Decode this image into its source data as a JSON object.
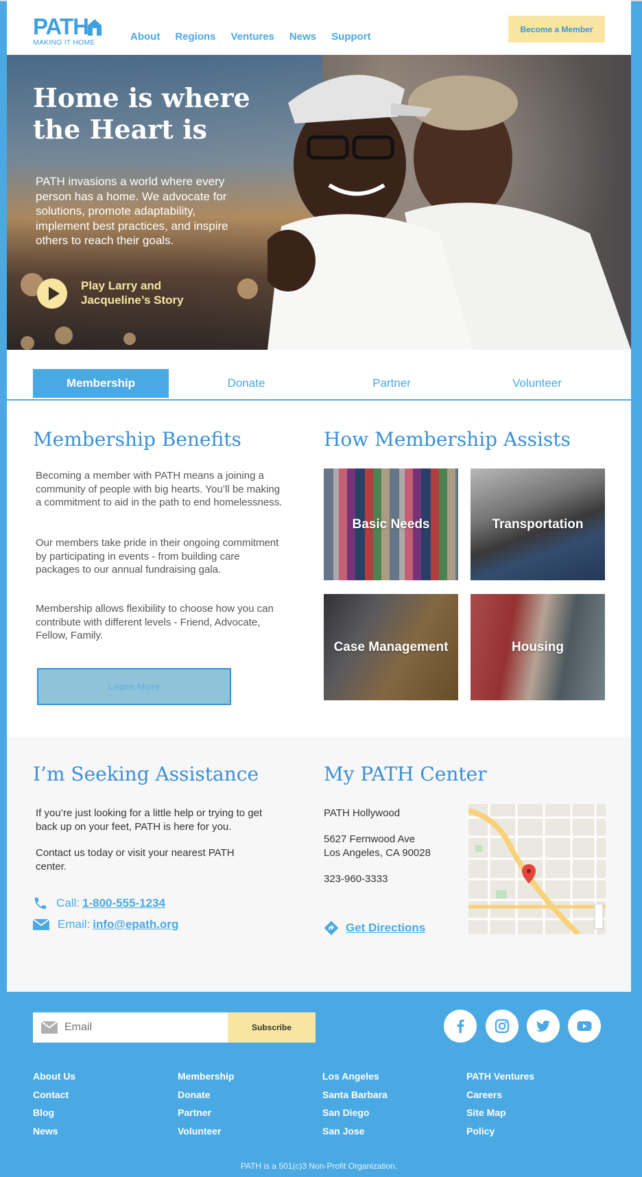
{
  "header": {
    "logo_text": "PATH",
    "logo_tagline": "MAKING IT HOME",
    "nav": [
      "About",
      "Regions",
      "Ventures",
      "News",
      "Support"
    ],
    "cta": "Become a Member"
  },
  "hero": {
    "title": "Home is where the Heart is",
    "description": "PATH invasions a world where every person has a home. We advocate for solutions, promote adaptability, implement best practices, and inspire others to reach their goals.",
    "play_label": "Play Larry and Jacqueline’s Story"
  },
  "tabs": [
    "Membership",
    "Donate",
    "Partner",
    "Volunteer"
  ],
  "benefits": {
    "title": "Membership Benefits",
    "paragraphs": [
      "Becoming a member with PATH means a joining a community of people with big hearts. You’ll be making a commitment to aid in the path to end homelessness.",
      "Our members take pride in their ongoing commitment by participating in events - from building care packages to our annual fundraising gala.",
      "Membership allows flexibility to choose how you can contribute with different levels - Friend, Advocate, Fellow, Family."
    ],
    "button": "Learn More"
  },
  "assists": {
    "title": "How Membership Assists",
    "tiles": [
      "Basic Needs",
      "Transportation",
      "Case Management",
      "Housing"
    ]
  },
  "seeking": {
    "title": "I’m Seeking Assistance",
    "paragraphs": [
      "If you’re just looking for a little help or trying to get back up on your feet, PATH is here for you.",
      "Contact us today or visit your nearest PATH center."
    ],
    "call_label": "Call:",
    "phone": "1-800-555-1234",
    "email_label": "Email:",
    "email": "info@epath.org"
  },
  "center": {
    "title": "My PATH Center",
    "name": "PATH Hollywood",
    "address_line1": "5627 Fernwood Ave",
    "address_line2": "Los Angeles, CA 90028",
    "phone": "323-960-3333",
    "directions": "Get Directions"
  },
  "footer": {
    "email_placeholder": "Email",
    "subscribe": "Subscribe",
    "columns": [
      [
        "About Us",
        "Contact",
        "Blog",
        "News"
      ],
      [
        "Membership",
        "Donate",
        "Partner",
        "Volunteer"
      ],
      [
        "Los Angeles",
        "Santa Barbara",
        "San Diego",
        "San Jose"
      ],
      [
        "PATH Ventures",
        "Careers",
        "Site Map",
        "Policy"
      ]
    ],
    "note": "PATH is a 501(c)3 Non-Profit Organization."
  },
  "colors": {
    "brand_blue": "#4aa9e3",
    "heading_blue": "#3a8fd6",
    "accent_yellow": "#f8e6a0"
  },
  "icons": [
    "play-icon",
    "phone-icon",
    "mail-icon",
    "directions-icon",
    "facebook-icon",
    "instagram-icon",
    "twitter-icon",
    "youtube-icon"
  ]
}
